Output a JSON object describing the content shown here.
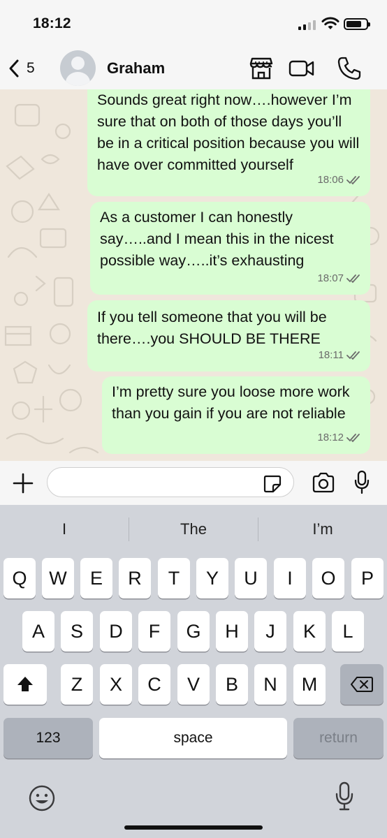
{
  "status_bar": {
    "time": "18:12"
  },
  "header": {
    "back_count": "5",
    "contact_name": "Graham"
  },
  "messages": [
    {
      "text": "Sounds great right now….however I’m sure that on both of those days you’ll be in a critical position because you will have over committed yourself",
      "time": "18:06"
    },
    {
      "text": "As a customer I can honestly say…..and I mean this in the nicest possible way…..it’s exhausting",
      "time": "18:07"
    },
    {
      "text": "If you tell someone that you will be there….you SHOULD BE THERE",
      "time": "18:11"
    },
    {
      "text": "I’m pretty sure you loose more work than you gain if you are not reliable",
      "time": "18:12"
    }
  ],
  "input": {
    "value": "",
    "placeholder": ""
  },
  "keyboard": {
    "suggestions": [
      "I",
      "The",
      "I’m"
    ],
    "row1": [
      "Q",
      "W",
      "E",
      "R",
      "T",
      "Y",
      "U",
      "I",
      "O",
      "P"
    ],
    "row2": [
      "A",
      "S",
      "D",
      "F",
      "G",
      "H",
      "J",
      "K",
      "L"
    ],
    "row3": [
      "Z",
      "X",
      "C",
      "V",
      "B",
      "N",
      "M"
    ],
    "numbers_label": "123",
    "space_label": "space",
    "return_label": "return"
  },
  "colors": {
    "bubble": "#d9fdd3",
    "chat_background": "#efe7dc",
    "read_ticks": "#6b6b6b"
  }
}
